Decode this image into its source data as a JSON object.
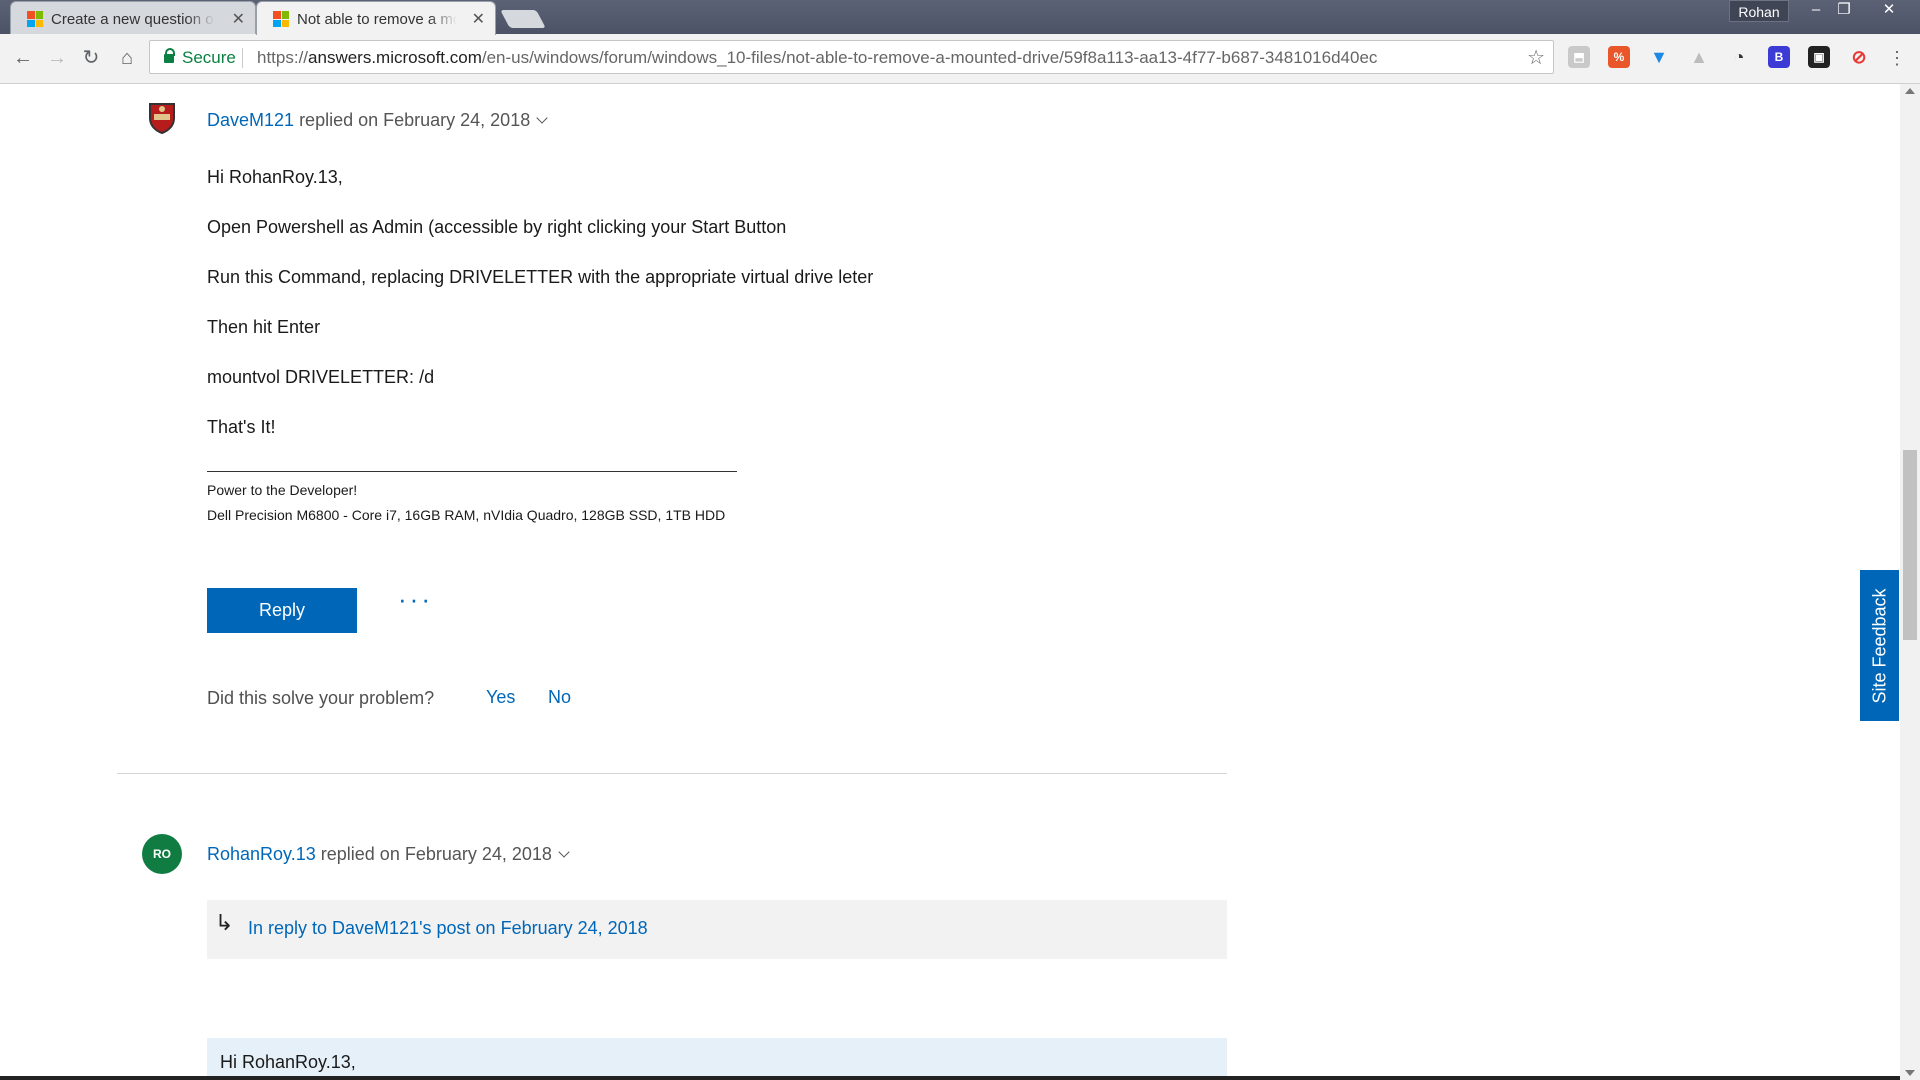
{
  "browser": {
    "tabs": [
      {
        "title": "Create a new question or start a discussion",
        "active": false
      },
      {
        "title": "Not able to remove a mounted drive",
        "active": true
      }
    ],
    "profile_name": "Rohan",
    "secure_label": "Secure",
    "url_scheme": "https://",
    "url_host": "answers.microsoft.com",
    "url_path": "/en-us/windows/forum/windows_10-files/not-able-to-remove-a-mounted-drive/59f8a113-aa13-4f77-b687-3481016d40ec"
  },
  "post1": {
    "author": "DaveM121",
    "replied_text": "replied on February 24, 2018",
    "lines": [
      "Hi RohanRoy.13,",
      "Open Powershell as Admin (accessible by right clicking your Start Button",
      "Run this Command, replacing DRIVELETTER with the appropriate virtual drive leter",
      "Then hit Enter",
      "mountvol DRIVELETTER: /d",
      "That's It!"
    ],
    "signature": [
      "Power to the Developer!",
      "Dell Precision M6800 - Core i7, 16GB RAM, nVIdia Quadro, 128GB SSD, 1TB HDD"
    ],
    "reply_label": "Reply",
    "more_label": "···",
    "solve_question": "Did this solve your problem?",
    "yes_label": "Yes",
    "no_label": "No"
  },
  "post2": {
    "avatar_initials": "RO",
    "author": "RohanRoy.13",
    "replied_text": "replied on February 24, 2018",
    "in_reply_to": "In reply to DaveM121's post on February 24, 2018",
    "quote_first_line": "Hi RohanRoy.13,"
  },
  "site_feedback_label": "Site Feedback",
  "colors": {
    "link": "#0067b8",
    "accent": "#0067b8",
    "avatar_green": "#107c41"
  }
}
